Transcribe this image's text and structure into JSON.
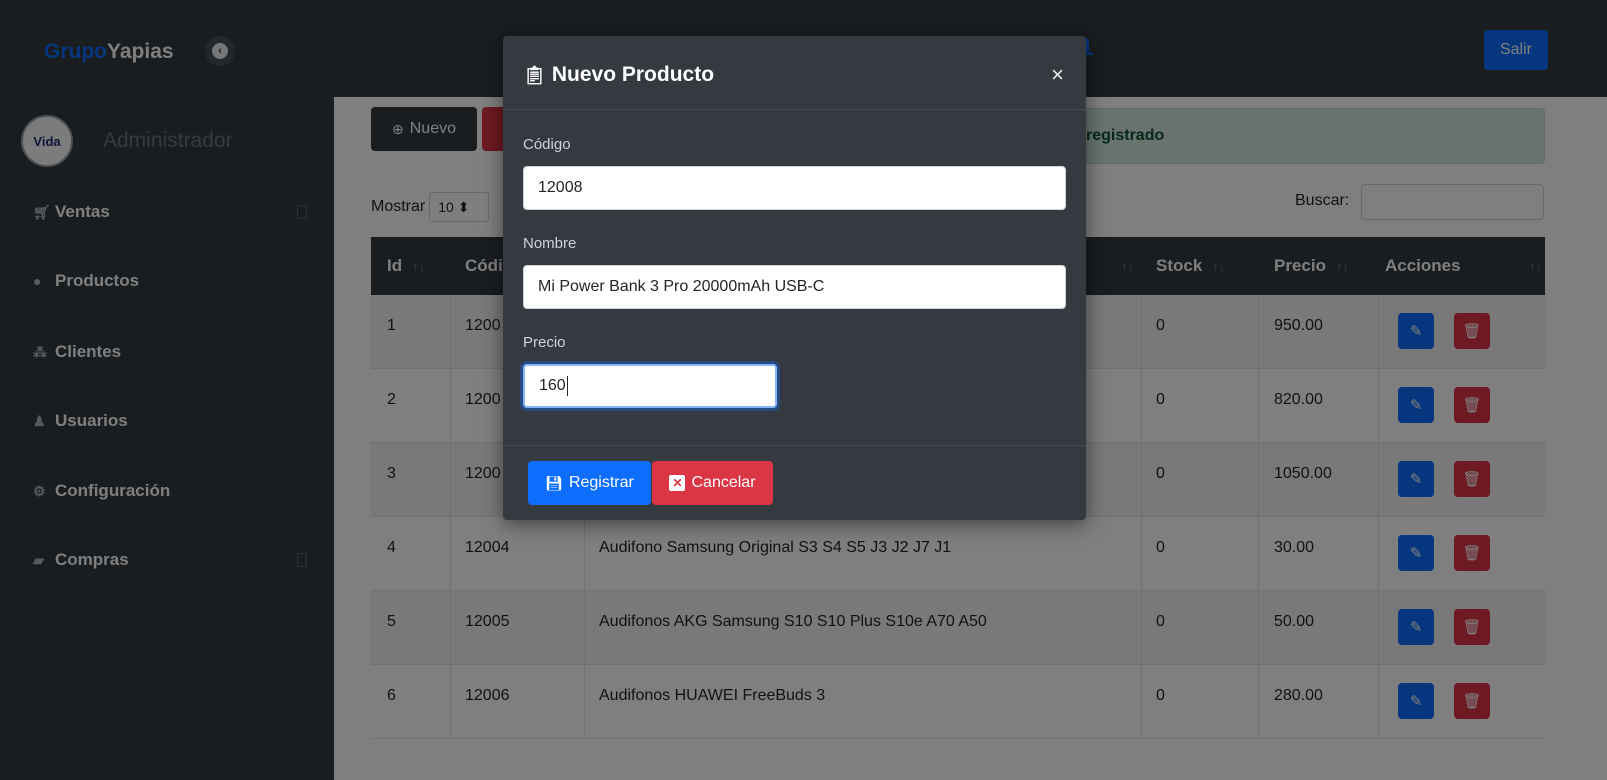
{
  "topbar": {
    "brand_part1": "Grupo",
    "brand_part2": "Yapias",
    "title_fragment": "1",
    "salir_label": "Salir"
  },
  "sidebar": {
    "user_name": "Administrador",
    "avatar_text": "Vida",
    "items": [
      {
        "label": "Ventas",
        "icon": "cart-icon",
        "has_caret": true
      },
      {
        "label": "Productos",
        "icon": "product-icon",
        "has_caret": false
      },
      {
        "label": "Clientes",
        "icon": "users-icon",
        "has_caret": false
      },
      {
        "label": "Usuarios",
        "icon": "user-icon",
        "has_caret": false
      },
      {
        "label": "Configuración",
        "icon": "cogs-icon",
        "has_caret": false
      },
      {
        "label": "Compras",
        "icon": "truck-icon",
        "has_caret": true
      }
    ]
  },
  "toolbar": {
    "nuevo_label": "Nuevo",
    "alert_text": "registrado"
  },
  "datatable": {
    "mostrar_label": "Mostrar",
    "page_size": "10",
    "buscar_label": "Buscar:",
    "columns": [
      "Id",
      "Códi",
      "Stock",
      "Precio",
      "Acciones"
    ],
    "rows": [
      {
        "id": "1",
        "codigo": "1200",
        "nombre": "",
        "stock": "0",
        "precio": "950.00"
      },
      {
        "id": "2",
        "codigo": "1200",
        "nombre": "",
        "stock": "0",
        "precio": "820.00"
      },
      {
        "id": "3",
        "codigo": "1200",
        "nombre": "",
        "stock": "0",
        "precio": "1050.00"
      },
      {
        "id": "4",
        "codigo": "12004",
        "nombre": "Audifono Samsung Original S3 S4 S5 J3 J2 J7 J1",
        "stock": "0",
        "precio": "30.00"
      },
      {
        "id": "5",
        "codigo": "12005",
        "nombre": "Audifonos AKG Samsung S10 S10 Plus S10e A70 A50",
        "stock": "0",
        "precio": "50.00"
      },
      {
        "id": "6",
        "codigo": "12006",
        "nombre": "Audifonos HUAWEI FreeBuds 3",
        "stock": "0",
        "precio": "280.00"
      }
    ]
  },
  "modal": {
    "title": "Nuevo Producto",
    "close_symbol": "×",
    "codigo_label": "Código",
    "codigo_value": "12008",
    "nombre_label": "Nombre",
    "nombre_value": "Mi Power Bank 3 Pro 20000mAh USB-C",
    "precio_label": "Precio",
    "precio_value": "160",
    "registrar_label": "Registrar",
    "cancelar_label": "Cancelar"
  },
  "colors": {
    "dark": "#343a40",
    "primary": "#0d6efd",
    "danger": "#dc3545",
    "success_bg": "#d1e7dd"
  }
}
